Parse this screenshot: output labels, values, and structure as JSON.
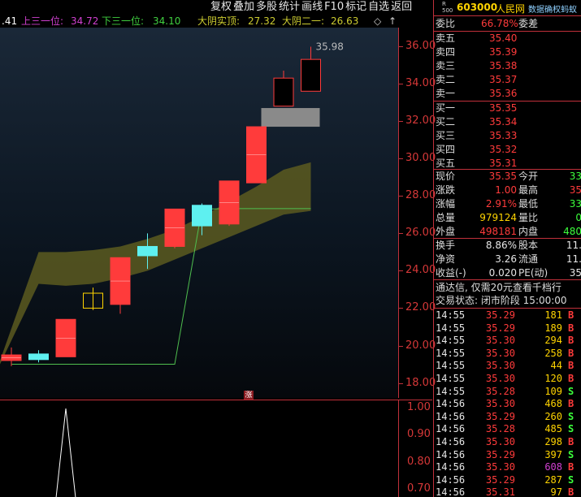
{
  "toolbar": {
    "items": [
      "复权",
      "叠加",
      "多股",
      "统计",
      "画线",
      "F10",
      "标记",
      "自选",
      "返回"
    ]
  },
  "indicator_header": [
    {
      "text": ".41",
      "color": "#ffffff"
    },
    {
      "text": "上三一位:",
      "color": "#d040d0"
    },
    {
      "text": "34.72",
      "color": "#d040d0"
    },
    {
      "text": "下三一位:",
      "color": "#40d040"
    },
    {
      "text": "34.10",
      "color": "#40d040"
    },
    {
      "text": "大阴实顶:",
      "color": "#cccc30"
    },
    {
      "text": "27.32",
      "color": "#cccc30"
    },
    {
      "text": "大阴二一:",
      "color": "#cccc30"
    },
    {
      "text": "26.63",
      "color": "#cccc30"
    }
  ],
  "controls": {
    "diamond": "◇",
    "up_arrow": "↑"
  },
  "chart_data": {
    "type": "candlestick",
    "ylim": [
      17.2,
      37.0
    ],
    "yticks": [
      "36.00",
      "34.00",
      "32.00",
      "30.00",
      "28.00",
      "26.00",
      "24.00",
      "22.00",
      "20.00",
      "18.00"
    ],
    "high_label": "35.98",
    "candles": [
      {
        "o": 19.2,
        "h": 19.9,
        "l": 18.9,
        "c": 19.5,
        "color": "red"
      },
      {
        "o": 19.25,
        "h": 19.75,
        "l": 19.1,
        "c": 19.55,
        "color": "cyan"
      },
      {
        "o": 19.4,
        "h": 21.4,
        "l": 19.4,
        "c": 21.4,
        "color": "red"
      },
      {
        "o": 22.0,
        "h": 23.1,
        "l": 21.9,
        "c": 22.8,
        "color": "yellow"
      },
      {
        "o": 22.2,
        "h": 24.7,
        "l": 21.7,
        "c": 24.7,
        "color": "red"
      },
      {
        "o": 25.3,
        "h": 26.0,
        "l": 24.1,
        "c": 24.8,
        "color": "cyan"
      },
      {
        "o": 25.3,
        "h": 27.3,
        "l": 25.2,
        "c": 27.3,
        "color": "red"
      },
      {
        "o": 27.5,
        "h": 27.6,
        "l": 25.9,
        "c": 26.4,
        "color": "cyan"
      },
      {
        "o": 26.5,
        "h": 28.8,
        "l": 26.4,
        "c": 28.8,
        "color": "red"
      },
      {
        "o": 28.7,
        "h": 31.7,
        "l": 28.7,
        "c": 31.7,
        "color": "red"
      },
      {
        "o": 32.8,
        "h": 34.7,
        "l": 32.8,
        "c": 34.3,
        "color": "red-hollow"
      },
      {
        "o": 33.6,
        "h": 35.98,
        "l": 33.6,
        "c": 35.3,
        "color": "red-hollow"
      }
    ],
    "band_upper": [
      19.2,
      25.0,
      25.0,
      25.1,
      25.3,
      25.7,
      26.2,
      26.9,
      27.7,
      28.5,
      29.4,
      29.8
    ],
    "band_lower": [
      19.0,
      23.3,
      23.2,
      23.3,
      23.6,
      24.0,
      24.6,
      25.2,
      25.8,
      26.4,
      27.0,
      27.2
    ],
    "support_line": [
      19.0,
      19.0,
      19.0,
      19.0,
      19.0,
      19.0,
      19.0,
      27.3,
      27.32,
      27.32,
      27.32,
      27.32
    ],
    "gray_box": {
      "ymin": 31.7,
      "ymax": 32.7
    },
    "lower_panel": {
      "yticks": [
        "1.00",
        "0.90",
        "0.80",
        "0.70"
      ],
      "ylim": [
        0.67,
        1.03
      ],
      "spike_candle_index": 2
    }
  },
  "marker_text": "涨",
  "quote": {
    "code": "603000",
    "name": "人民网",
    "r500": "R\n500",
    "ad_text": "数据确权蚂蚁",
    "wb_label": "委比",
    "wb_value": "66.78%",
    "wc_label": "委差",
    "wc_value": "",
    "asks": [
      {
        "label": "卖五",
        "price": "35.40",
        "vol": ""
      },
      {
        "label": "卖四",
        "price": "35.39",
        "vol": ""
      },
      {
        "label": "卖三",
        "price": "35.38",
        "vol": ""
      },
      {
        "label": "卖二",
        "price": "35.37",
        "vol": ""
      },
      {
        "label": "卖一",
        "price": "35.36",
        "vol": ""
      }
    ],
    "bids": [
      {
        "label": "买一",
        "price": "35.35",
        "vol": ""
      },
      {
        "label": "买二",
        "price": "35.34",
        "vol": ""
      },
      {
        "label": "买三",
        "price": "35.33",
        "vol": ""
      },
      {
        "label": "买四",
        "price": "35.32",
        "vol": ""
      },
      {
        "label": "买五",
        "price": "35.31",
        "vol": ""
      }
    ],
    "stats": [
      {
        "l1": "现价",
        "v1": "35.35",
        "c1": "#ff3b3b",
        "l2": "今开",
        "v2": "33",
        "c2": "#3cff3c"
      },
      {
        "l1": "涨跌",
        "v1": "1.00",
        "c1": "#ff3b3b",
        "l2": "最高",
        "v2": "35",
        "c2": "#ff3b3b"
      },
      {
        "l1": "涨幅",
        "v1": "2.91%",
        "c1": "#ff3b3b",
        "l2": "最低",
        "v2": "33",
        "c2": "#3cff3c"
      },
      {
        "l1": "总量",
        "v1": "979124",
        "c1": "#ffd400",
        "l2": "量比",
        "v2": "0",
        "c2": "#3cff3c"
      },
      {
        "l1": "外盘",
        "v1": "498181",
        "c1": "#ff3b3b",
        "l2": "内盘",
        "v2": "480",
        "c2": "#3cff3c"
      }
    ],
    "stats2": [
      {
        "l1": "换手",
        "v1": "8.86%",
        "c1": "#e6e6e6",
        "l2": "股本",
        "v2": "11.",
        "c2": "#e6e6e6"
      },
      {
        "l1": "净资",
        "v1": "3.26",
        "c1": "#e6e6e6",
        "l2": "流通",
        "v2": "11.",
        "c2": "#e6e6e6"
      },
      {
        "l1": "收益(-)",
        "v1": "0.020",
        "c1": "#e6e6e6",
        "l2": "PE(动)",
        "v2": "35",
        "c2": "#e6e6e6"
      }
    ],
    "notice": "通达信, 仅需20元查看千档行",
    "trade_status": "交易状态: 闭市阶段 15:00:00"
  },
  "ticks": [
    {
      "time": "14:55",
      "price": "35.29",
      "vol": "181",
      "side": "B"
    },
    {
      "time": "14:55",
      "price": "35.29",
      "vol": "189",
      "side": "B"
    },
    {
      "time": "14:55",
      "price": "35.30",
      "vol": "294",
      "side": "B"
    },
    {
      "time": "14:55",
      "price": "35.30",
      "vol": "258",
      "side": "B"
    },
    {
      "time": "14:55",
      "price": "35.30",
      "vol": "44",
      "side": "B"
    },
    {
      "time": "14:55",
      "price": "35.30",
      "vol": "120",
      "side": "B"
    },
    {
      "time": "14:55",
      "price": "35.28",
      "vol": "109",
      "side": "S"
    },
    {
      "time": "14:56",
      "price": "35.30",
      "vol": "468",
      "side": "B"
    },
    {
      "time": "14:56",
      "price": "35.29",
      "vol": "260",
      "side": "S"
    },
    {
      "time": "14:56",
      "price": "35.28",
      "vol": "485",
      "side": "S"
    },
    {
      "time": "14:56",
      "price": "35.30",
      "vol": "298",
      "side": "B"
    },
    {
      "time": "14:56",
      "price": "35.29",
      "vol": "397",
      "side": "S"
    },
    {
      "time": "14:56",
      "price": "35.30",
      "vol": "608",
      "side": "B",
      "vol_color": "#d040d0"
    },
    {
      "time": "14:56",
      "price": "35.29",
      "vol": "287",
      "side": "S"
    },
    {
      "time": "14:56",
      "price": "35.31",
      "vol": "97",
      "side": "B"
    }
  ],
  "colors": {
    "up": "#ff3b3b",
    "down_cyan": "#5ef0f0",
    "buy": "#ff3b3b",
    "sell": "#3cff3c",
    "tick_vol": "#ffd400",
    "band": "#5c5a20"
  }
}
